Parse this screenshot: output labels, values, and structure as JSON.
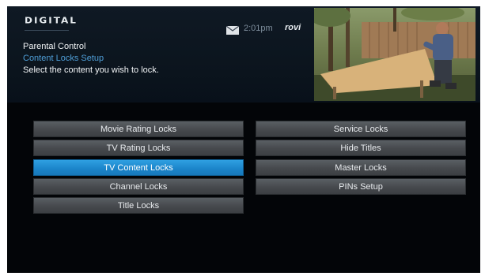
{
  "header": {
    "logo": "DIGITAL",
    "clock": "2:01pm",
    "brand": "rovi",
    "title": "Parental Control",
    "subtitle": "Content Locks Setup",
    "instruction": "Select the content you wish to lock."
  },
  "menu": {
    "left": [
      {
        "label": "Movie Rating Locks",
        "selected": false
      },
      {
        "label": "TV Rating Locks",
        "selected": false
      },
      {
        "label": "TV Content Locks",
        "selected": true
      },
      {
        "label": "Channel Locks",
        "selected": false
      },
      {
        "label": "Title Locks",
        "selected": false
      }
    ],
    "right": [
      {
        "label": "Service Locks",
        "selected": false
      },
      {
        "label": "Hide Titles",
        "selected": false
      },
      {
        "label": "Master Locks",
        "selected": false
      },
      {
        "label": "PINs Setup",
        "selected": false
      }
    ]
  },
  "colors": {
    "selected": "#1b84c9",
    "button": "#46494d",
    "subtitle": "#4f9fd8",
    "background": "#030508"
  },
  "icons": [
    "mail-icon"
  ]
}
